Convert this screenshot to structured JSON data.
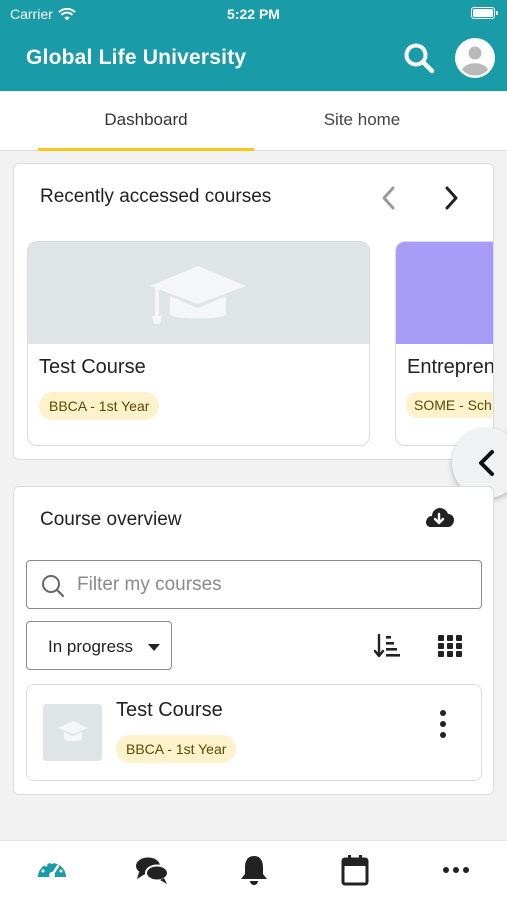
{
  "status_bar": {
    "carrier": "Carrier",
    "time": "5:22 PM"
  },
  "header": {
    "title": "Global Life University"
  },
  "tabs": [
    {
      "label": "Dashboard",
      "active": true
    },
    {
      "label": "Site home",
      "active": false
    }
  ],
  "recent": {
    "title": "Recently accessed courses",
    "courses": [
      {
        "name": "Test Course",
        "category": "BBCA - 1st Year",
        "image_color": "#dfe4e6"
      },
      {
        "name": "Entrepren",
        "category": "SOME - Sch Entrepreneu",
        "image_color": "#a89cf7"
      }
    ]
  },
  "overview": {
    "title": "Course overview",
    "search_placeholder": "Filter my courses",
    "filter_value": "In progress",
    "courses": [
      {
        "name": "Test Course",
        "category": "BBCA - 1st Year"
      }
    ]
  },
  "colors": {
    "brand": "#1a9ba8",
    "tab_indicator": "#f5c518",
    "badge_bg": "#fdf2cb",
    "active_nav": "#1a9ba8"
  },
  "bottom_nav": [
    {
      "icon": "dashboard-icon",
      "active": true
    },
    {
      "icon": "messages-icon",
      "active": false
    },
    {
      "icon": "notifications-icon",
      "active": false
    },
    {
      "icon": "calendar-icon",
      "active": false
    },
    {
      "icon": "more-icon",
      "active": false
    }
  ]
}
